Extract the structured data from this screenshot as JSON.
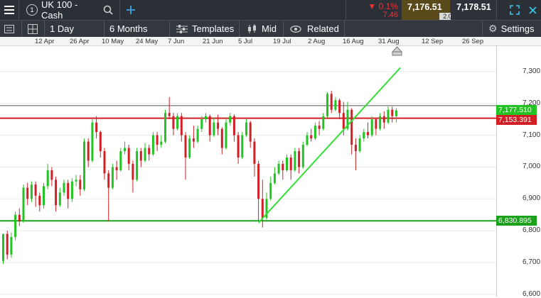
{
  "topbar": {
    "instrument_badge": "1",
    "instrument_name": "UK 100 - Cash",
    "change_percent": "0.1%",
    "change_points": "7.46",
    "sell_price": "7,176.51",
    "spread": "2.00",
    "buy_price": "7,178.51"
  },
  "toolbar": {
    "interval": "1 Day",
    "range": "6 Months",
    "templates": "Templates",
    "price_type": "Mid",
    "related": "Related",
    "settings": "Settings"
  },
  "dates": [
    "12 Apr",
    "26 Apr",
    "10 May",
    "24 May",
    "7 Jun",
    "21 Jun",
    "5 Jul",
    "19 Jul",
    "2 Aug",
    "16 Aug",
    "31 Aug",
    "12 Sep",
    "26 Sep"
  ],
  "yaxis": [
    "7,300.000",
    "7,200.000",
    "7,100.000",
    "7,000.000",
    "6,900.000",
    "6,800.000",
    "6,700.000",
    "6,600.000"
  ],
  "labels": {
    "current_price": "7,177.510",
    "resistance": "7,153.391",
    "support": "6,830.895"
  },
  "colors": {
    "up": "#22c322",
    "down": "#d21f26",
    "resistance": "#d21f26",
    "support": "#1aa31a",
    "trend": "#33e033",
    "topbar": "#2b2f36",
    "toolbar": "#33373e",
    "sell_bg": "#5a4a1a"
  },
  "chart_data": {
    "type": "candlestick",
    "ylim": [
      6593,
      7380
    ],
    "candles": [
      [
        6705,
        6790,
        6695,
        6790
      ],
      [
        6790,
        6725,
        6710,
        6800
      ],
      [
        6725,
        6780,
        6715,
        6795
      ],
      [
        6780,
        6850,
        6770,
        6860
      ],
      [
        6850,
        6830,
        6815,
        6870
      ],
      [
        6830,
        6935,
        6825,
        6945
      ],
      [
        6935,
        6900,
        6880,
        6950
      ],
      [
        6900,
        6945,
        6890,
        6955
      ],
      [
        6945,
        6910,
        6875,
        6955
      ],
      [
        6910,
        6880,
        6860,
        6920
      ],
      [
        6880,
        6940,
        6870,
        6950
      ],
      [
        6940,
        6990,
        6930,
        7010
      ],
      [
        6990,
        6960,
        6940,
        7000
      ],
      [
        6960,
        6880,
        6860,
        6970
      ],
      [
        6880,
        6920,
        6875,
        6935
      ],
      [
        6920,
        6950,
        6910,
        6960
      ],
      [
        6950,
        6900,
        6870,
        6960
      ],
      [
        6900,
        6955,
        6890,
        6965
      ],
      [
        6955,
        6960,
        6940,
        6975
      ],
      [
        6960,
        6930,
        6910,
        6975
      ],
      [
        6930,
        7080,
        6925,
        7090
      ],
      [
        7080,
        7020,
        7000,
        7090
      ],
      [
        7020,
        7140,
        7015,
        7150
      ],
      [
        7140,
        7110,
        7090,
        7160
      ],
      [
        7110,
        7050,
        7030,
        7115
      ],
      [
        7050,
        6980,
        6960,
        7060
      ],
      [
        6980,
        6935,
        6830,
        6990
      ],
      [
        6935,
        7000,
        6930,
        7010
      ],
      [
        7000,
        6990,
        6960,
        7020
      ],
      [
        6990,
        7050,
        6985,
        7060
      ],
      [
        7050,
        7060,
        7040,
        7080
      ],
      [
        7060,
        7010,
        6990,
        7070
      ],
      [
        7010,
        6960,
        6920,
        7020
      ],
      [
        6960,
        7050,
        6955,
        7060
      ],
      [
        7050,
        7020,
        7000,
        7060
      ],
      [
        7020,
        7060,
        7015,
        7075
      ],
      [
        7060,
        7040,
        7020,
        7070
      ],
      [
        7040,
        7100,
        7035,
        7110
      ],
      [
        7100,
        7070,
        7050,
        7110
      ],
      [
        7070,
        7080,
        7060,
        7100
      ],
      [
        7080,
        7170,
        7075,
        7180
      ],
      [
        7170,
        7160,
        7150,
        7220
      ],
      [
        7160,
        7120,
        7100,
        7170
      ],
      [
        7120,
        7160,
        7115,
        7170
      ],
      [
        7160,
        7100,
        7080,
        7170
      ],
      [
        7100,
        7030,
        6960,
        7110
      ],
      [
        7030,
        7090,
        7025,
        7100
      ],
      [
        7090,
        7080,
        7060,
        7130
      ],
      [
        7080,
        7120,
        7075,
        7130
      ],
      [
        7120,
        7150,
        7110,
        7160
      ],
      [
        7150,
        7160,
        7140,
        7170
      ],
      [
        7160,
        7100,
        7080,
        7165
      ],
      [
        7100,
        7140,
        7095,
        7155
      ],
      [
        7140,
        7120,
        7100,
        7165
      ],
      [
        7120,
        7060,
        7040,
        7125
      ],
      [
        7060,
        7140,
        7055,
        7150
      ],
      [
        7140,
        7160,
        7130,
        7170
      ],
      [
        7160,
        7100,
        7080,
        7165
      ],
      [
        7100,
        7030,
        7010,
        7110
      ],
      [
        7030,
        7100,
        7025,
        7110
      ],
      [
        7100,
        7140,
        7095,
        7150
      ],
      [
        7140,
        7080,
        7060,
        7145
      ],
      [
        7080,
        7010,
        6970,
        7090
      ],
      [
        7010,
        6900,
        6830,
        7020
      ],
      [
        6900,
        6840,
        6810,
        6960
      ],
      [
        6840,
        6900,
        6835,
        6920
      ],
      [
        6900,
        6950,
        6895,
        6970
      ],
      [
        6950,
        6980,
        6945,
        7000
      ],
      [
        6980,
        7010,
        6975,
        7020
      ],
      [
        7010,
        6990,
        6960,
        7020
      ],
      [
        6990,
        7030,
        6985,
        7040
      ],
      [
        7030,
        6990,
        6960,
        7040
      ],
      [
        6990,
        7050,
        6985,
        7060
      ],
      [
        7050,
        7000,
        6980,
        7060
      ],
      [
        7000,
        7070,
        6995,
        7080
      ],
      [
        7070,
        7100,
        7065,
        7110
      ],
      [
        7100,
        7090,
        7080,
        7120
      ],
      [
        7090,
        7130,
        7085,
        7140
      ],
      [
        7130,
        7120,
        7100,
        7145
      ],
      [
        7120,
        7160,
        7115,
        7170
      ],
      [
        7160,
        7230,
        7155,
        7235
      ],
      [
        7230,
        7180,
        7170,
        7240
      ],
      [
        7180,
        7210,
        7175,
        7220
      ],
      [
        7210,
        7170,
        7150,
        7215
      ],
      [
        7170,
        7120,
        7100,
        7205
      ],
      [
        7120,
        7180,
        7115,
        7205
      ],
      [
        7180,
        7070,
        7040,
        7185
      ],
      [
        7070,
        7050,
        6990,
        7090
      ],
      [
        7050,
        7090,
        7045,
        7100
      ],
      [
        7090,
        7110,
        7080,
        7120
      ],
      [
        7110,
        7100,
        7090,
        7140
      ],
      [
        7100,
        7150,
        7095,
        7160
      ],
      [
        7150,
        7120,
        7100,
        7155
      ],
      [
        7120,
        7160,
        7115,
        7170
      ],
      [
        7160,
        7140,
        7120,
        7175
      ],
      [
        7140,
        7180,
        7135,
        7190
      ],
      [
        7180,
        7160,
        7140,
        7190
      ],
      [
        7160,
        7178,
        7140,
        7185
      ]
    ],
    "levels": {
      "current": 7177.51,
      "resistance": 7153.391,
      "support": 6830.895
    },
    "trendline": [
      [
        6825,
        63
      ],
      [
        7312,
        98
      ]
    ]
  }
}
